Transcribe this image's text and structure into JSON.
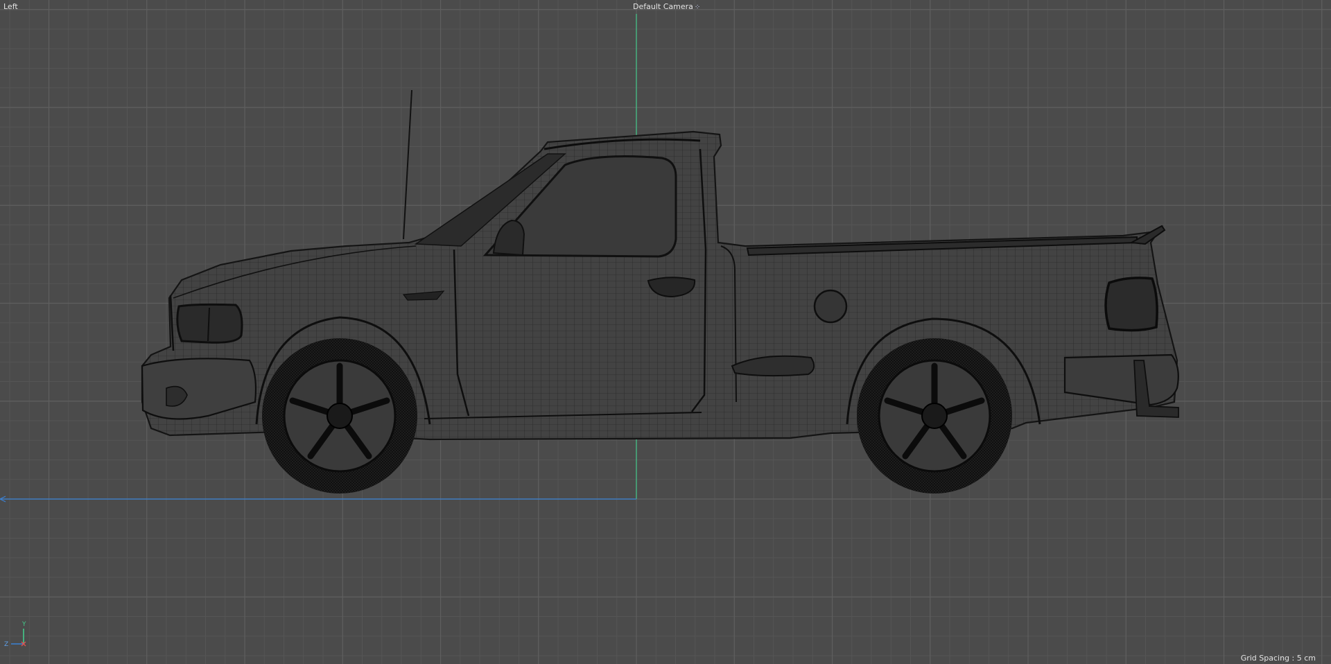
{
  "viewport": {
    "view_name": "Left",
    "camera_label": "Default Camera",
    "camera_icon": "eye-dots-icon",
    "grid_label": "Grid Spacing : 5 cm"
  },
  "axis_gizmo": {
    "y": "Y",
    "z": "Z"
  },
  "colors": {
    "background": "#4b4b4b",
    "grid_minor": "#555555",
    "grid_major": "#5f5f5f",
    "y_axis": "#43c98a",
    "z_axis": "#3b82d6",
    "wire": "#141414",
    "body_shade": "#444444",
    "tire": "#0e0e0e",
    "text": "#e4e4e4"
  },
  "model": {
    "name": "pickup-truck",
    "wireframe": true
  }
}
